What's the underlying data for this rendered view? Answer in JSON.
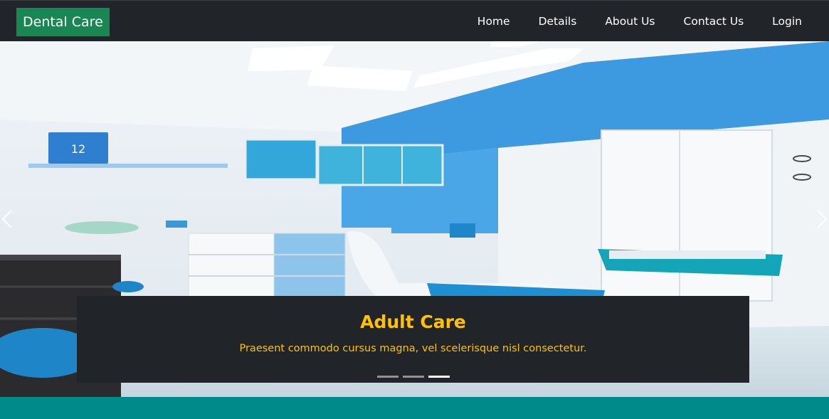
{
  "navbar": {
    "brand": "Dental Care",
    "links": [
      "Home",
      "Details",
      "About Us",
      "Contact Us",
      "Login"
    ]
  },
  "carousel": {
    "caption_title": "Adult Care",
    "caption_text": "Praesent commodo cursus magna, vel scelerisque nisl consectetur.",
    "slide_count": 3,
    "active_slide": 3
  },
  "colors": {
    "navbar_bg": "#212529",
    "brand_bg": "#198754",
    "caption_text": "#ffc107",
    "section_bg": "#008b8b"
  }
}
